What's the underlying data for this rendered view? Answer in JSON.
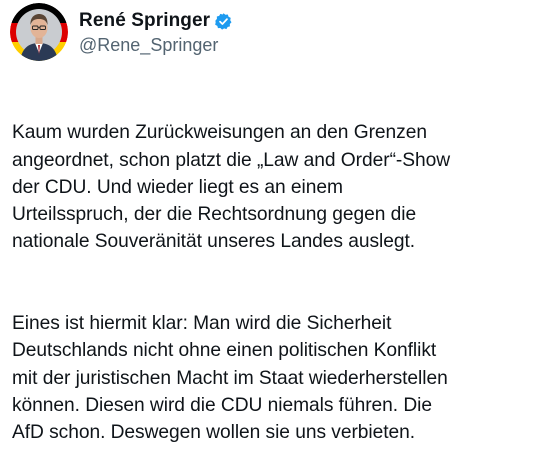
{
  "author": {
    "display_name": "René Springer",
    "handle": "@Rene_Springer",
    "verified_badge_color": "#1d9bf0",
    "avatar_ring_colors": [
      "#000000",
      "#dd0000",
      "#ffce00"
    ]
  },
  "post": {
    "paragraphs": [
      "Kaum wurden Zurückweisungen an den Grenzen\nangeordnet, schon platzt die „Law and Order“-Show\nder CDU. Und wieder liegt es an einem\nUrteilsspruch, der die Rechtsordnung gegen die\nnationale Souveränität unseres Landes auslegt.",
      "Eines ist hiermit klar: Man wird die Sicherheit\nDeutschlands nicht ohne einen politischen Konflikt\nmit der juristischen Macht im Staat wiederherstellen\nkönnen. Diesen wird die CDU niemals führen. Die\nAfD schon. Deswegen wollen sie uns verbieten."
    ]
  }
}
